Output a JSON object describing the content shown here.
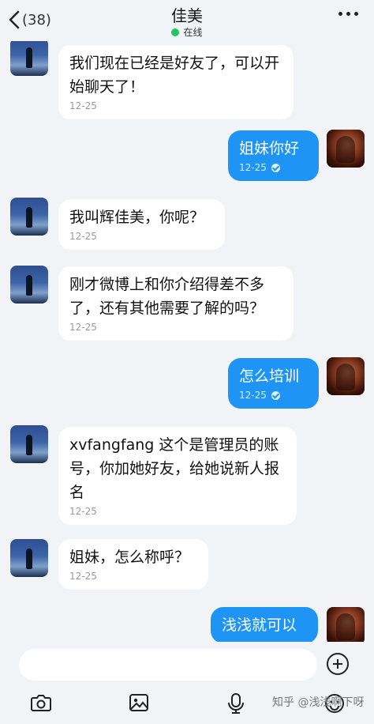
{
  "header": {
    "unread_count": "(38)",
    "contact_name": "佳美",
    "status": "在线"
  },
  "messages": [
    {
      "side": "left",
      "text": "我们现在已经是好友了，可以开始聊天了！",
      "time": "12-25"
    },
    {
      "side": "right",
      "text": "姐妹你好",
      "time": "12-25"
    },
    {
      "side": "left",
      "text": "我叫辉佳美，你呢？",
      "time": "12-25"
    },
    {
      "side": "left",
      "text": "刚才微博上和你介绍得差不多了，还有其他需要了解的吗？",
      "time": "12-25"
    },
    {
      "side": "right",
      "text": "怎么培训",
      "time": "12-25"
    },
    {
      "side": "left",
      "text": "xvfangfang 这个是管理员的账号，你加她好友，给她说新人报名",
      "time": "12-25"
    },
    {
      "side": "left",
      "text": "姐妹，怎么称呼？",
      "time": "12-25"
    },
    {
      "side": "right",
      "text": "浅浅就可以",
      "time": ""
    }
  ],
  "input": {
    "value": "",
    "placeholder": ""
  },
  "toolbar": [
    "camera-icon",
    "image-icon",
    "microphone-icon",
    "emoji-icon"
  ],
  "watermark": "知乎 @浅浅啊下呀",
  "colors": {
    "accent": "#1e94f5",
    "online": "#22c55e",
    "background": "#f2f3f7"
  }
}
